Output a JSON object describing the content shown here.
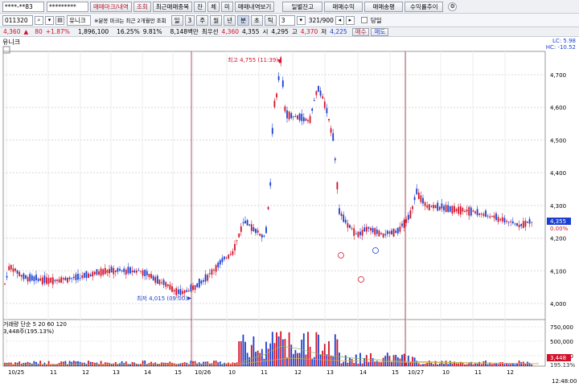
{
  "toolbar": {
    "account_field": "****-**83",
    "password_field": "*********",
    "btn_markers": "매매마크/내역",
    "btn_query": "조회",
    "btn_recent": "최근매매종목",
    "btn_balance": "잔",
    "btn_all": "체",
    "btn_me": "미",
    "btn_trade_view": "매매내역보기",
    "btn_daily": "일별잔고",
    "btn_profit": "매매수익",
    "btn_trading": "매매송평",
    "btn_profit_rate": "수익률추이"
  },
  "row2": {
    "stock_code": "011320",
    "stock_name": "유니크",
    "notice": "※분봉 마크는 최근 2개월만 조회",
    "period_labels": [
      "일",
      "3",
      "주",
      "월",
      "년",
      "분",
      "초",
      "틱"
    ],
    "interval_value": "3",
    "count": "321/900",
    "checkbox_label": "당일"
  },
  "quote": {
    "price": "4,360",
    "change": "80",
    "change_pct": "+1.87%",
    "volume": "1,896,100",
    "turnover_pct": "16.25%",
    "strength": "9.81%",
    "amount": "8,148백만",
    "prev_label": "최우선",
    "prev_value": "4,360",
    "ask": "4,355",
    "open_label": "시",
    "open": "4,295",
    "high_label": "고",
    "high": "4,370",
    "low_label": "저",
    "low": "4,225",
    "buy": "매수",
    "sell": "매도"
  },
  "chart": {
    "title": "유니크",
    "legend_lc": "LC: 5.98",
    "legend_hc": "HC: -10.52",
    "high_annotation": "최고 4,755 (11:39)",
    "low_annotation": "최저 4,015 (09:00)",
    "current_price": "4,355",
    "current_pct": "0.00%",
    "price_axis": [
      "4,700",
      "4,600",
      "4,500",
      "4,400",
      "4,300",
      "4,200",
      "4,100",
      "4,000"
    ],
    "volume_legend": "거래량 단순 5 20 60 120",
    "volume_info": "3,448주(195.13%)",
    "volume_axis": [
      "750,000",
      "500,000",
      "250,000"
    ],
    "volume_last": "3,448",
    "volume_last_pct": "195.13%",
    "x_labels": [
      "10/25",
      "11",
      "12",
      "13",
      "14",
      "15",
      "10/26",
      "10",
      "11",
      "12",
      "13",
      "14",
      "15",
      "10/27",
      "10",
      "11",
      "12"
    ],
    "time_label": "12:48:00"
  },
  "colors": {
    "up": "#d1122a",
    "down": "#1a3fcf",
    "grid": "#c9c9c9",
    "sessionline": "#a0283c"
  }
}
